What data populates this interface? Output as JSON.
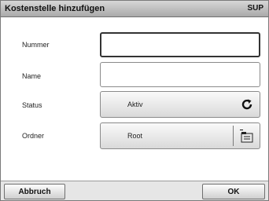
{
  "window": {
    "title": "Kostenstelle hinzufügen",
    "badge": "SUP"
  },
  "form": {
    "nummer": {
      "label": "Nummer",
      "value": ""
    },
    "name": {
      "label": "Name",
      "value": ""
    },
    "status": {
      "label": "Status",
      "value": "Aktiv",
      "icon": "refresh-icon"
    },
    "ordner": {
      "label": "Ordner",
      "value": "Root",
      "icon": "folder-picker-icon"
    }
  },
  "buttons": {
    "cancel": "Abbruch",
    "ok": "OK"
  }
}
